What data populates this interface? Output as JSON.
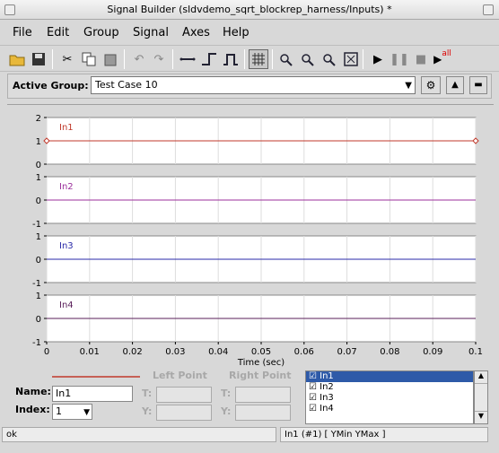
{
  "window": {
    "title": "Signal Builder (sldvdemo_sqrt_blockrep_harness/Inputs) *"
  },
  "menu": [
    {
      "label": "File"
    },
    {
      "label": "Edit"
    },
    {
      "label": "Group"
    },
    {
      "label": "Signal"
    },
    {
      "label": "Axes"
    },
    {
      "label": "Help"
    }
  ],
  "toolbar": {
    "icons": [
      "open-folder-icon",
      "save-icon",
      "cut-icon",
      "copy-icon",
      "paste-icon",
      "undo-icon",
      "redo-icon",
      "constant-signal-icon",
      "step-signal-icon",
      "pulse-signal-icon",
      "grid-icon",
      "zoom-x-icon",
      "zoom-y-icon",
      "zoom-xy-icon",
      "fit-view-icon",
      "play-icon",
      "pause-icon",
      "stop-icon",
      "run-all-icon"
    ],
    "run_all_label": "all"
  },
  "active_group": {
    "label": "Active Group:",
    "value": "Test Case 10"
  },
  "chart_data": {
    "type": "line",
    "xlabel": "Time (sec)",
    "x_ticks": [
      "0",
      "0.01",
      "0.02",
      "0.03",
      "0.04",
      "0.05",
      "0.06",
      "0.07",
      "0.08",
      "0.09",
      "0.1"
    ],
    "xlim": [
      0,
      0.1
    ],
    "panels": [
      {
        "name": "In1",
        "color": "#c0392b",
        "yticks": [
          "2",
          "1",
          "0"
        ],
        "ylim": [
          0,
          2
        ],
        "x": [
          0,
          0.1
        ],
        "y": [
          1,
          1
        ]
      },
      {
        "name": "In2",
        "color": "#9b2f9b",
        "yticks": [
          "1",
          "0",
          "-1"
        ],
        "ylim": [
          -1,
          1
        ],
        "x": [
          0,
          0.1
        ],
        "y": [
          0,
          0
        ]
      },
      {
        "name": "In3",
        "color": "#2a2aa8",
        "yticks": [
          "1",
          "0",
          "-1"
        ],
        "ylim": [
          -1,
          1
        ],
        "x": [
          0,
          0.1
        ],
        "y": [
          0,
          0
        ]
      },
      {
        "name": "In4",
        "color": "#5a1f5a",
        "yticks": [
          "1",
          "0",
          "-1"
        ],
        "ylim": [
          -1,
          1
        ],
        "x": [
          0,
          0.1
        ],
        "y": [
          0,
          0
        ]
      }
    ]
  },
  "signal_props": {
    "name_label": "Name:",
    "name_value": "In1",
    "index_label": "Index:",
    "index_value": "1",
    "left_point_label": "Left Point",
    "right_point_label": "Right Point",
    "t_label": "T:",
    "y_label": "Y:"
  },
  "signal_list": [
    {
      "label": "☑ In1",
      "selected": true
    },
    {
      "label": "☑ In2",
      "selected": false
    },
    {
      "label": "☑ In3",
      "selected": false
    },
    {
      "label": "☑ In4",
      "selected": false
    }
  ],
  "status": {
    "left": "ok",
    "right": "In1 (#1)  [ YMin YMax ]"
  }
}
